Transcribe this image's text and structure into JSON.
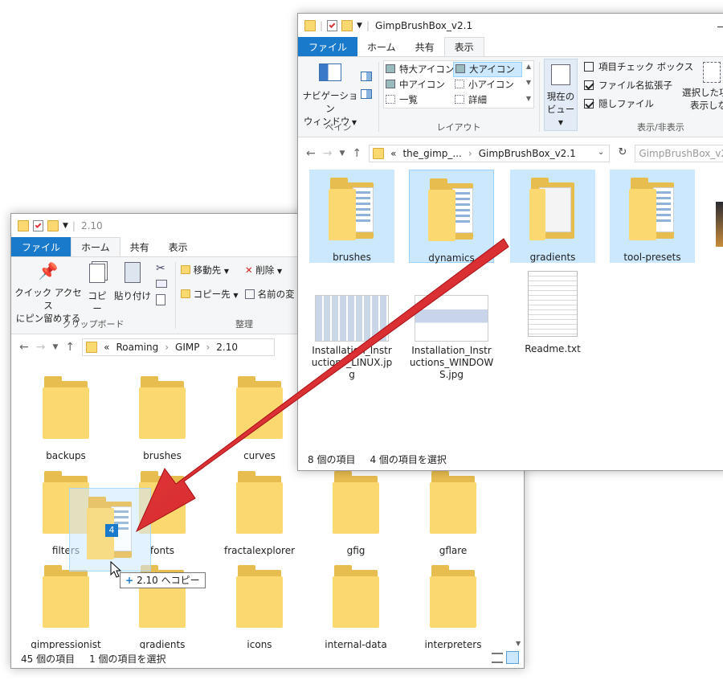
{
  "back_window": {
    "title": "2.10",
    "tabs": [
      "ファイル",
      "ホーム",
      "共有",
      "表示"
    ],
    "ribbon": {
      "pin_label_1": "クイック アクセス",
      "pin_label_2": "にピン留めする",
      "copy_label": "コピー",
      "paste_label": "貼り付け",
      "clipboard_group": "クリップボード",
      "move_to": "移動先",
      "delete": "削除",
      "copy_to": "コピー先",
      "rename": "名前の変",
      "organize_group": "整理"
    },
    "address": {
      "prefix": "«",
      "crumbs": [
        "Roaming",
        "GIMP",
        "2.10"
      ]
    },
    "folders": [
      "backups",
      "brushes",
      "curves",
      "filters",
      "fonts",
      "fractalexplorer",
      "gfig",
      "gflare",
      "gimpressionist",
      "gradients",
      "icons",
      "internal-data",
      "interpreters"
    ],
    "status_count": "45 個の項目",
    "status_selected": "1 個の項目を選択"
  },
  "drag": {
    "badge": "4",
    "tooltip": "2.10 へコピー",
    "tooltip_plus": "+"
  },
  "front_window": {
    "title": "GimpBrushBox_v2.1",
    "tabs": [
      "ファイル",
      "ホーム",
      "共有",
      "表示"
    ],
    "ribbon": {
      "pane_label_1": "ナビゲーション",
      "pane_label_2": "ウィンドウ",
      "pane_group": "ペイン",
      "layout_options": [
        "特大アイコン",
        "大アイコン",
        "中アイコン",
        "小アイコン",
        "一覧",
        "詳細"
      ],
      "layout_group": "レイアウト",
      "current_view_1": "現在の",
      "current_view_2": "ビュー",
      "check_item": "項目チェック ボックス",
      "ext_item": "ファイル名拡張子",
      "hidden_item": "隠しファイル",
      "showhide_group": "表示/非表示",
      "hide_selected_1": "選択した項",
      "hide_selected_2": "表示しな"
    },
    "address": {
      "prefix": "«",
      "crumbs": [
        "the_gimp_...",
        "GimpBrushBox_v2.1"
      ]
    },
    "search_placeholder": "GimpBrushBox_v2",
    "folders": [
      "brushes",
      "dynamics",
      "gradients",
      "tool-presets"
    ],
    "files": [
      "Installation_Instructions_LINUX.jpg",
      "Installation_Instructions_WINDOWS.jpg",
      "Readme.txt"
    ],
    "status_count": "8 個の項目",
    "status_selected": "4 個の項目を選択"
  },
  "colors": {
    "accent": "#1979ca",
    "selection": "#cce8ff",
    "arrow": "#e32222",
    "folder": "#fcd870"
  }
}
